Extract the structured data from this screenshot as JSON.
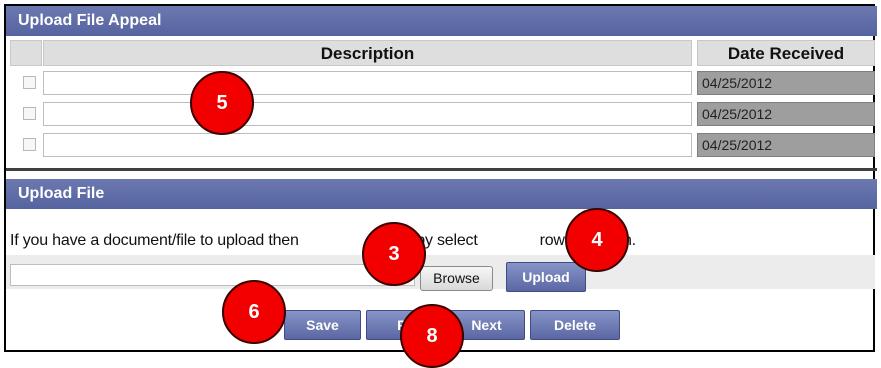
{
  "appeal_section": {
    "title": "Upload File Appeal",
    "columns": {
      "description": "Description",
      "date_received": "Date Received"
    },
    "rows": [
      {
        "description": "",
        "date_received": "04/25/2012"
      },
      {
        "description": "",
        "date_received": "04/25/2012"
      },
      {
        "description": "",
        "date_received": "04/25/2012"
      }
    ]
  },
  "upload_section": {
    "title": "Upload File",
    "instruction_parts": [
      "If you have a document/file to upload then",
      "he file by select",
      "rowse' button."
    ],
    "file_value": "",
    "browse_label": "Browse",
    "upload_label": "Upload"
  },
  "nav": {
    "save_label": "Save",
    "prev_label": "Pr",
    "next_label": "Next",
    "delete_label": "Delete"
  },
  "callouts": [
    "5",
    "3",
    "4",
    "6",
    "8"
  ],
  "colors": {
    "header": "#5e6aa6",
    "callout": "#f20000",
    "date_bg": "#9e9e9e"
  }
}
